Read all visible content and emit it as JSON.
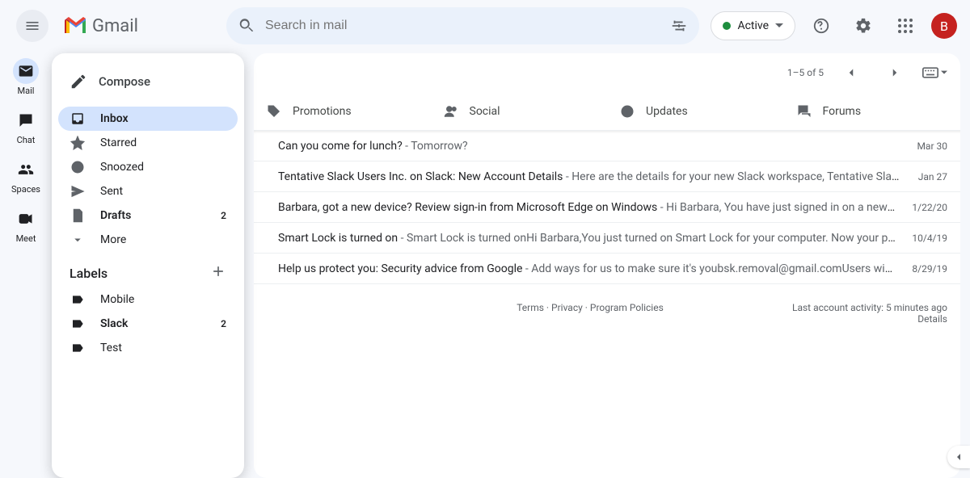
{
  "header": {
    "app_name": "Gmail",
    "search_placeholder": "Search in mail",
    "status_label": "Active",
    "avatar_initial": "B"
  },
  "rail": {
    "items": [
      {
        "label": "Mail"
      },
      {
        "label": "Chat"
      },
      {
        "label": "Spaces"
      },
      {
        "label": "Meet"
      }
    ]
  },
  "sidebar": {
    "compose_label": "Compose",
    "items": [
      {
        "label": "Inbox",
        "count": ""
      },
      {
        "label": "Starred",
        "count": ""
      },
      {
        "label": "Snoozed",
        "count": ""
      },
      {
        "label": "Sent",
        "count": ""
      },
      {
        "label": "Drafts",
        "count": "2"
      },
      {
        "label": "More",
        "count": ""
      }
    ],
    "labels_header": "Labels",
    "labels": [
      {
        "label": "Mobile",
        "count": ""
      },
      {
        "label": "Slack",
        "count": "2"
      },
      {
        "label": "Test",
        "count": ""
      }
    ]
  },
  "toolbar": {
    "range_text": "1–5 of 5"
  },
  "tabs": [
    {
      "label": "Promotions"
    },
    {
      "label": "Social"
    },
    {
      "label": "Updates"
    },
    {
      "label": "Forums"
    }
  ],
  "messages": [
    {
      "subject": "Can you come for lunch?",
      "sep": " - ",
      "body": "Tomorrow?",
      "date": "Mar 30"
    },
    {
      "subject": "Tentative Slack Users Inc. on Slack: New Account Details",
      "sep": " - ",
      "body": "Here are the details for your new Slack workspace, Tentative Slack …",
      "date": "Jan 27"
    },
    {
      "subject": "Barbara, got a new device? Review sign-in from Microsoft Edge on Windows",
      "sep": " - ",
      "body": "Hi Barbara, You have just signed in on a new co…",
      "date": "1/22/20"
    },
    {
      "subject": "Smart Lock is turned on",
      "sep": " - ",
      "body": "Smart Lock is turned onHi Barbara,You just turned on Smart Lock for your computer. Now your pho…",
      "date": "10/4/19"
    },
    {
      "subject": "Help us protect you: Security advice from Google",
      "sep": " - ",
      "body": "Add ways for us to make sure it's youbsk.removal@gmail.comUsers with …",
      "date": "8/29/19"
    }
  ],
  "footer": {
    "terms": "Terms",
    "privacy": "Privacy",
    "policies": "Program Policies",
    "activity": "Last account activity: 5 minutes ago",
    "details": "Details"
  }
}
